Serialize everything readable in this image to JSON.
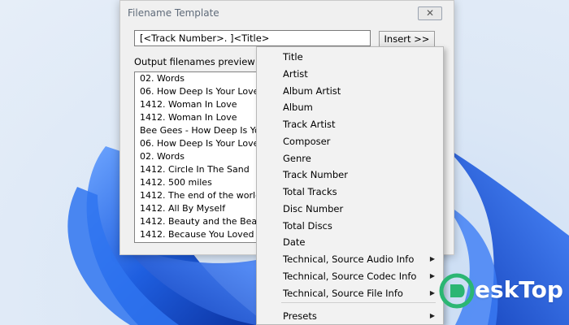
{
  "dialog": {
    "title": "Filename Template",
    "close_glyph": "✕",
    "template_value": "[<Track Number>. ]<Title>",
    "insert_label": "Insert >>",
    "preview_label": "Output filenames preview",
    "preview_rows": [
      "02. Words",
      "06. How Deep Is Your Love",
      "1412. Woman In Love",
      "1412. Woman In Love",
      "Bee Gees - How Deep Is Your Love",
      "06. How Deep Is Your Love",
      "02. Words",
      "1412. Circle In The Sand",
      "1412. 500 miles",
      "1412. The end of the world",
      "1412. All By Myself",
      "1412. Beauty and the Beast",
      "1412. Because You Loved Me"
    ]
  },
  "menu": {
    "items": [
      {
        "label": "Title",
        "has_submenu": false
      },
      {
        "label": "Artist",
        "has_submenu": false
      },
      {
        "label": "Album Artist",
        "has_submenu": false
      },
      {
        "label": "Album",
        "has_submenu": false
      },
      {
        "label": "Track Artist",
        "has_submenu": false
      },
      {
        "label": "Composer",
        "has_submenu": false
      },
      {
        "label": "Genre",
        "has_submenu": false
      },
      {
        "label": "Track Number",
        "has_submenu": false
      },
      {
        "label": "Total Tracks",
        "has_submenu": false
      },
      {
        "label": "Disc Number",
        "has_submenu": false
      },
      {
        "label": "Total Discs",
        "has_submenu": false
      },
      {
        "label": "Date",
        "has_submenu": false
      },
      {
        "label": "Technical, Source Audio Info",
        "has_submenu": true
      },
      {
        "label": "Technical, Source Codec Info",
        "has_submenu": true
      },
      {
        "label": "Technical, Source File Info",
        "has_submenu": true
      },
      {
        "label": "Presets",
        "has_submenu": true
      }
    ],
    "arrow_glyph": "▶"
  },
  "watermark": {
    "text": "eskTop",
    "logo_icon": "desktop-logo-icon"
  },
  "colors": {
    "wallpaper_blue": "#1f5fe0",
    "wallpaper_bg": "#dbe7f6",
    "watermark_green": "#2bb673"
  }
}
